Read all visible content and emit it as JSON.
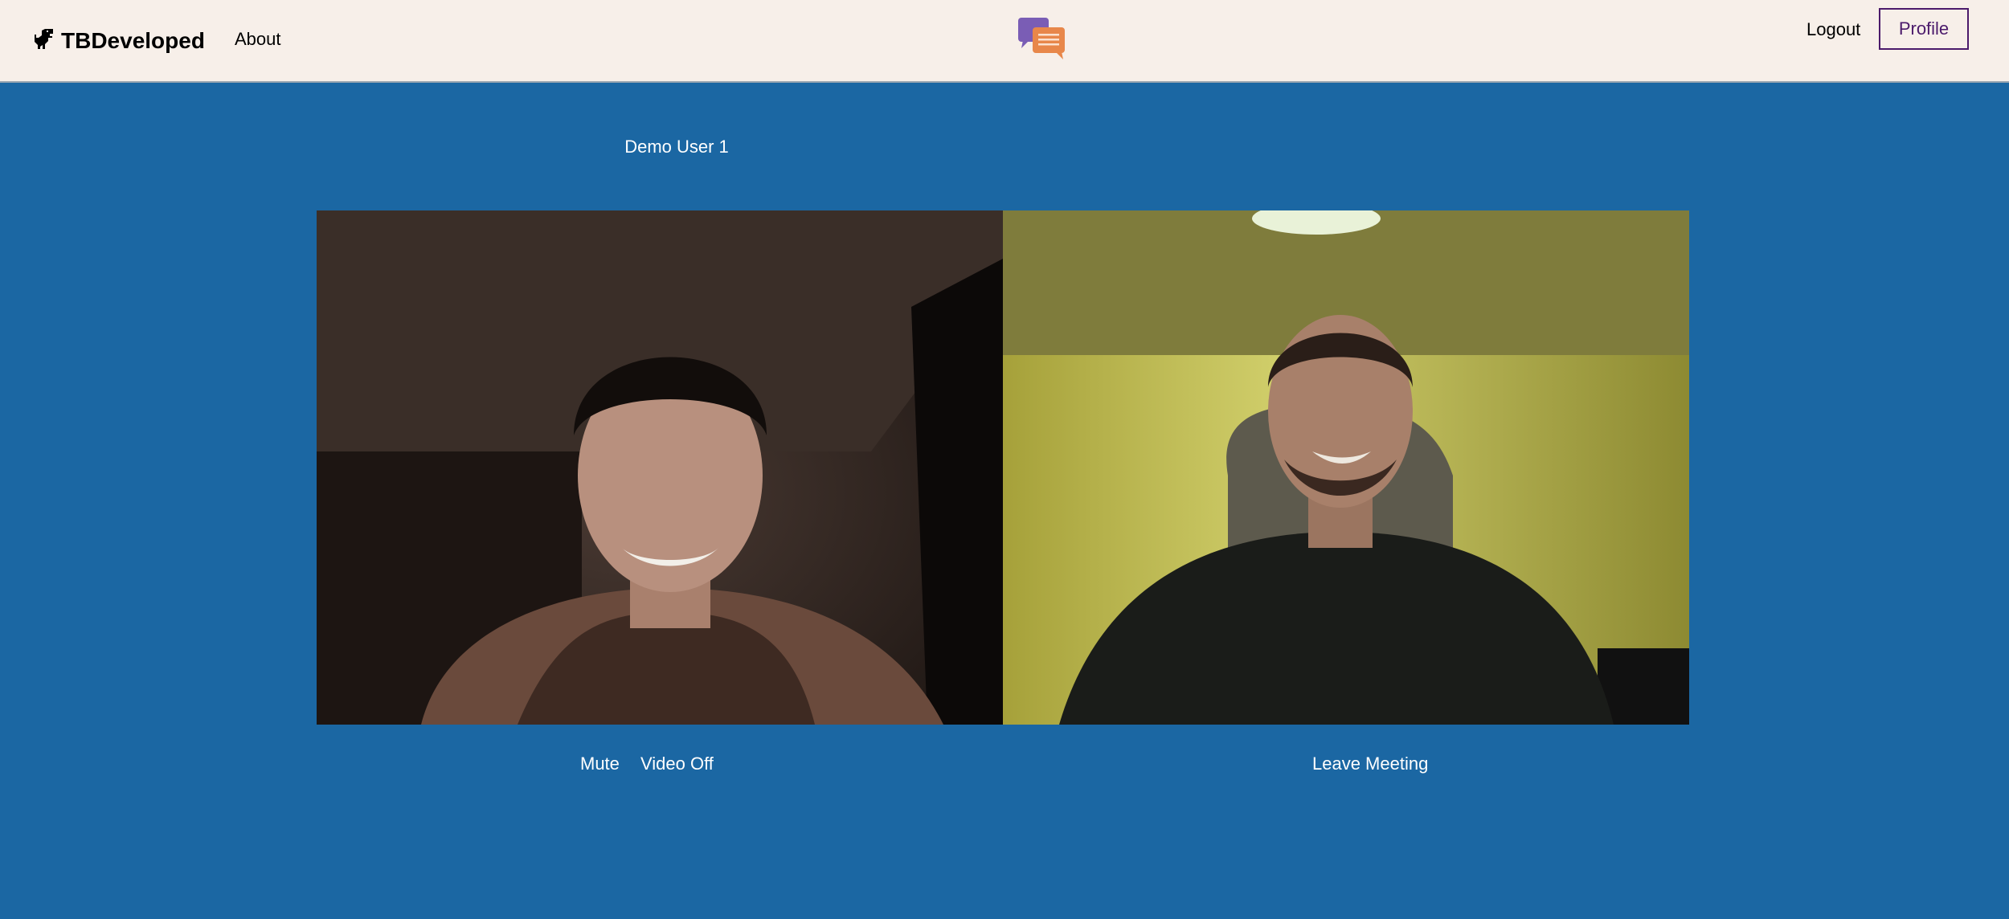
{
  "navbar": {
    "brand": "TBDeveloped",
    "about": "About",
    "logout": "Logout",
    "profile": "Profile",
    "brand_icon": "dinosaur-icon",
    "center_icon": "chat-bubbles-icon"
  },
  "meeting": {
    "user_name": "Demo User 1",
    "controls": {
      "mute": "Mute",
      "video_off": "Video Off",
      "leave": "Leave Meeting"
    }
  },
  "colors": {
    "navbar_bg": "#f7efe9",
    "page_bg": "#1b67a3",
    "profile_accent": "#4b1a6b",
    "bubble_purple": "#7a5db5",
    "bubble_orange": "#e8874a"
  }
}
